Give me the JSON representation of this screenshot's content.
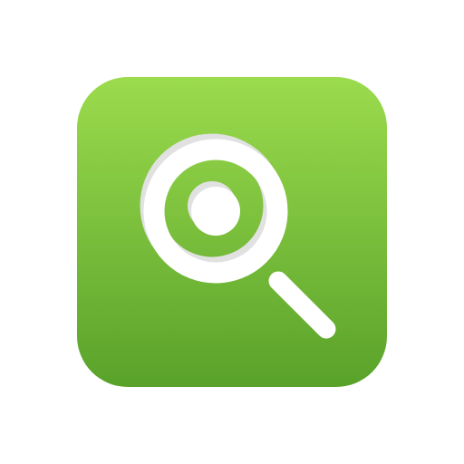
{
  "app_icon": {
    "icon": "magnifying-glass-icon",
    "background_top": "#9BDB4D",
    "background_bottom": "#59A22A",
    "glyph_color": "#FFFFFF",
    "glyph_shadow": "#E1E1E1"
  }
}
